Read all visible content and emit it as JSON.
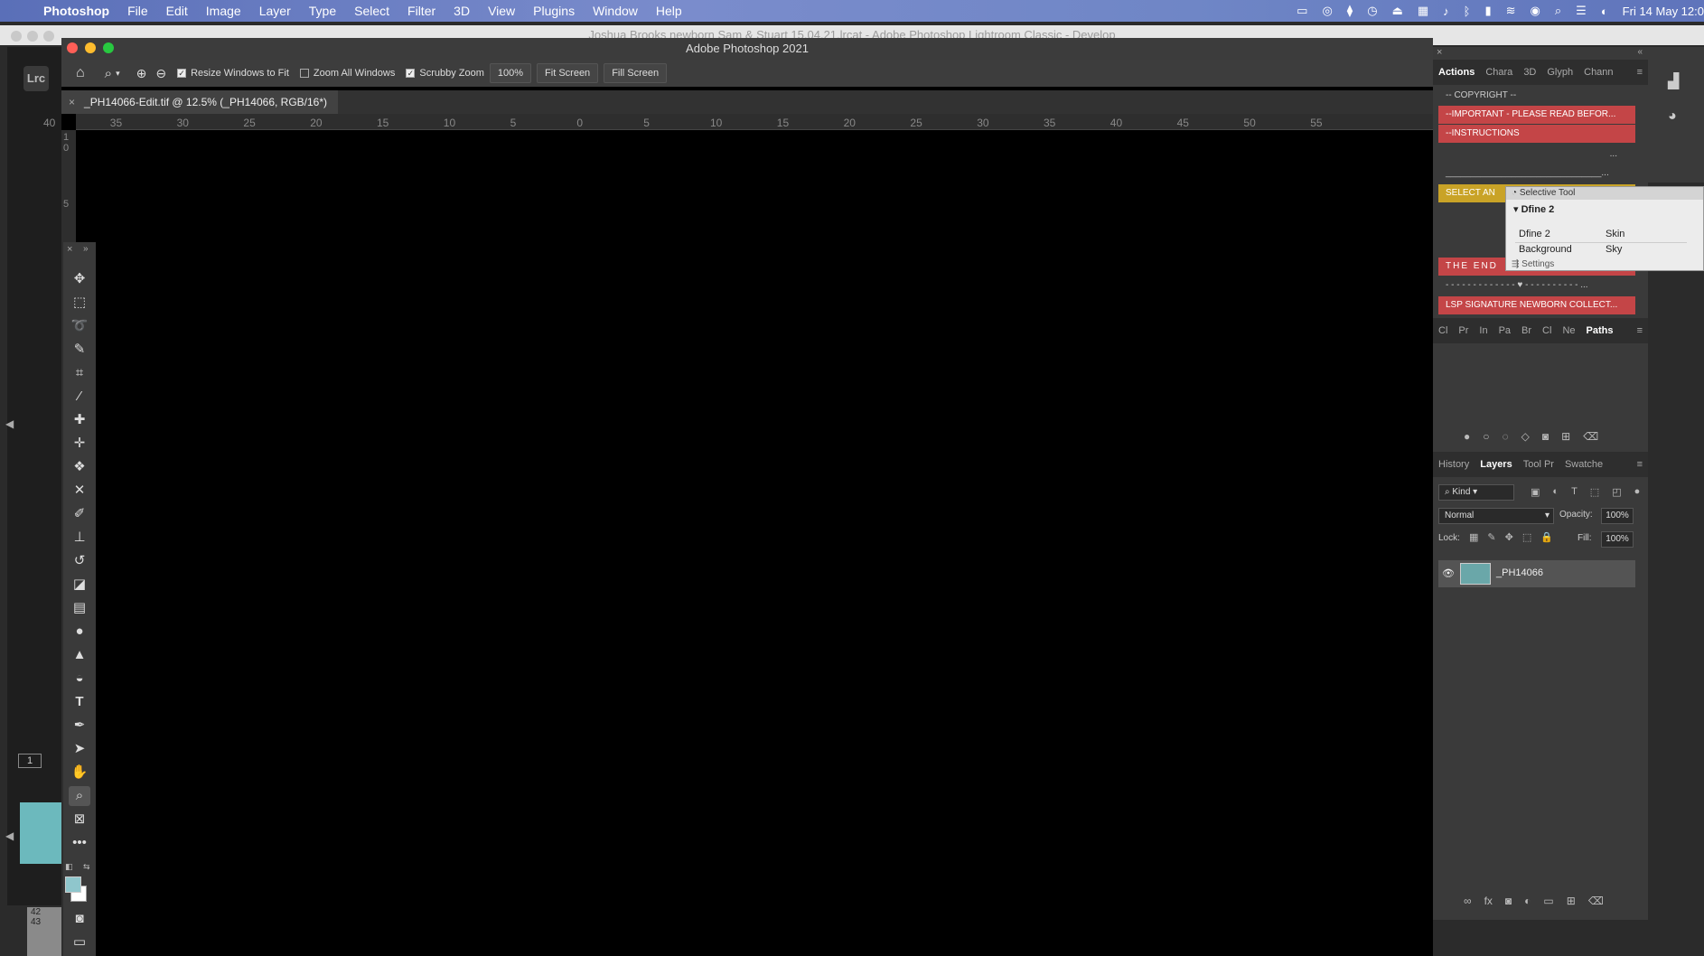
{
  "menubar": {
    "app": "Photoshop",
    "items": [
      "File",
      "Edit",
      "Image",
      "Layer",
      "Type",
      "Select",
      "Filter",
      "3D",
      "View",
      "Plugins",
      "Window",
      "Help"
    ],
    "clock": "Fri 14 May 12:0"
  },
  "lightroom": {
    "window_title": "Joshua Brooks newborn Sam & Stuart 15.04.21.lrcat - Adobe Photoshop Lightroom Classic - Develop",
    "logo": "Lrc",
    "filmstrip_index": "1",
    "row_numbers": [
      "42",
      "43"
    ]
  },
  "photoshop": {
    "window_title": "Adobe Photoshop 2021",
    "options": {
      "resize_windows": "Resize Windows to Fit",
      "zoom_all": "Zoom All Windows",
      "scrubby_zoom": "Scrubby Zoom",
      "zoom_level": "100%",
      "fit_screen": "Fit Screen",
      "fill_screen": "Fill Screen"
    },
    "doc_tab": "_PH14066-Edit.tif @ 12.5% (_PH14066, RGB/16*)",
    "ruler_h": [
      "40",
      "35",
      "30",
      "25",
      "20",
      "15",
      "10",
      "5",
      "0",
      "5",
      "10",
      "15",
      "20",
      "25",
      "30",
      "35",
      "40",
      "45",
      "50",
      "55"
    ],
    "ruler_v": [
      "1",
      "0",
      "5"
    ]
  },
  "actions_panel": {
    "tabs": [
      "Actions",
      "Chara",
      "3D",
      "Glyph",
      "Chann"
    ],
    "items": [
      {
        "label": "-- COPYRIGHT --",
        "style": "plain"
      },
      {
        "label": "--IMPORTANT - PLEASE READ BEFOR...",
        "style": "red"
      },
      {
        "label": "--INSTRUCTIONS",
        "style": "red"
      },
      {
        "label": "...",
        "style": "plain"
      },
      {
        "label": "_______________________________...",
        "style": "plain"
      },
      {
        "label": "SELECT AN",
        "style": "yellow"
      },
      {
        "label": "THE END",
        "style": "red"
      },
      {
        "label": "- - - - - - - - - - - - - ♥ - - - - - - - - - - ...",
        "style": "plain"
      },
      {
        "label": "LSP SIGNATURE NEWBORN COLLECT...",
        "style": "red"
      }
    ]
  },
  "selective_tool": {
    "title": "Selective Tool",
    "group": "Dfine 2",
    "cells": [
      "Dfine 2",
      "Skin",
      "Background",
      "Sky"
    ],
    "settings": "Settings"
  },
  "paths_panel": {
    "tabs": [
      "Cl",
      "Pr",
      "In",
      "Pa",
      "Br",
      "Cl",
      "Ne",
      "Paths"
    ]
  },
  "layers_panel": {
    "tabs": [
      "History",
      "Layers",
      "Tool Pr",
      "Swatche"
    ],
    "kind": "Kind",
    "blend_mode": "Normal",
    "opacity_label": "Opacity:",
    "opacity": "100%",
    "lock_label": "Lock:",
    "fill_label": "Fill:",
    "fill": "100%",
    "layer_name": "_PH14066"
  },
  "colors": {
    "menubar": "#6f86c6",
    "action_red": "#c44547",
    "action_yellow": "#c9a327",
    "foreground_swatch": "#8fc6cc"
  }
}
